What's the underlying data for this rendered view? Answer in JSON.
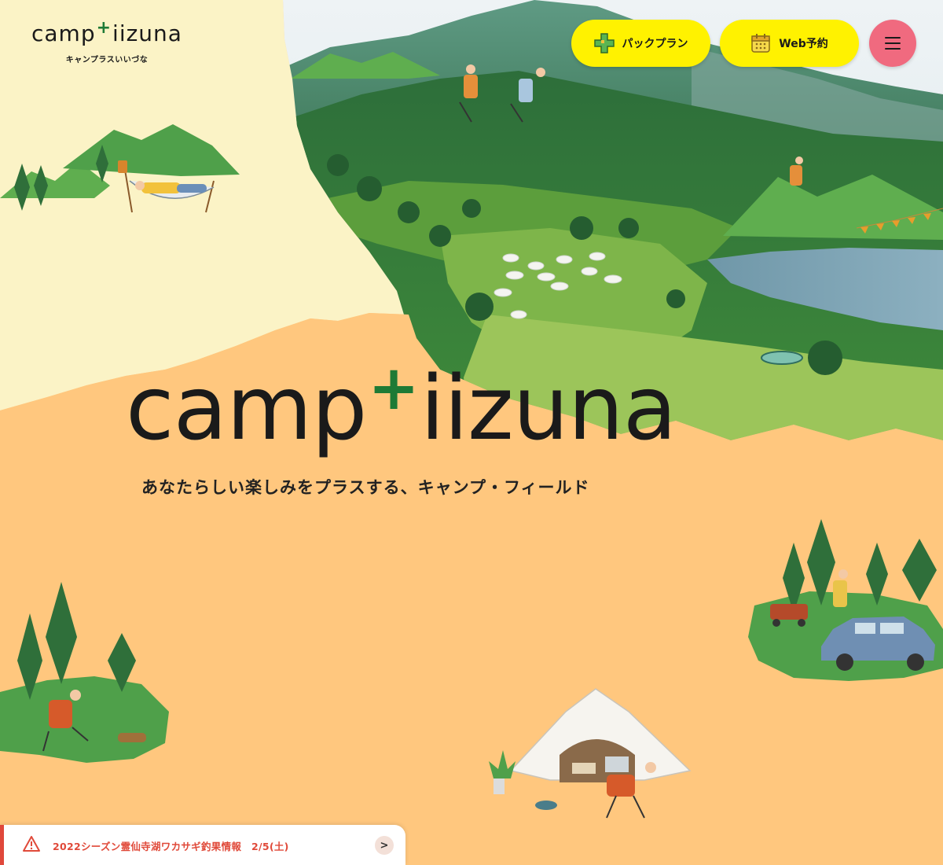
{
  "header": {
    "logo_word_left": "camp",
    "logo_plus": "+",
    "logo_word_right": "iizuna",
    "logo_kana": "キャンプラスいいづな"
  },
  "nav": {
    "pack_plan_label": "パックプラン",
    "web_reserve_label": "Web予約",
    "menu_icon": "hamburger-icon",
    "pack_plan_icon": "plus-icon",
    "web_reserve_icon": "calendar-icon"
  },
  "hero": {
    "title_left": "camp",
    "title_plus": "+",
    "title_right": "iizuna",
    "tagline": "あなたらしい楽しみをプラスする、キャンプ・フィールド"
  },
  "news": {
    "icon": "warning-icon",
    "text": "2022シーズン霊仙寺湖ワカサギ釣果情報　2/5(土)",
    "arrow": ">"
  },
  "colors": {
    "accent_yellow": "#fff200",
    "menu_pink": "#f06a7f",
    "background_orange": "#ffc77e",
    "paper_cream": "#fbf3c6",
    "brand_green": "#1e7a35",
    "news_red": "#e04a3a"
  }
}
